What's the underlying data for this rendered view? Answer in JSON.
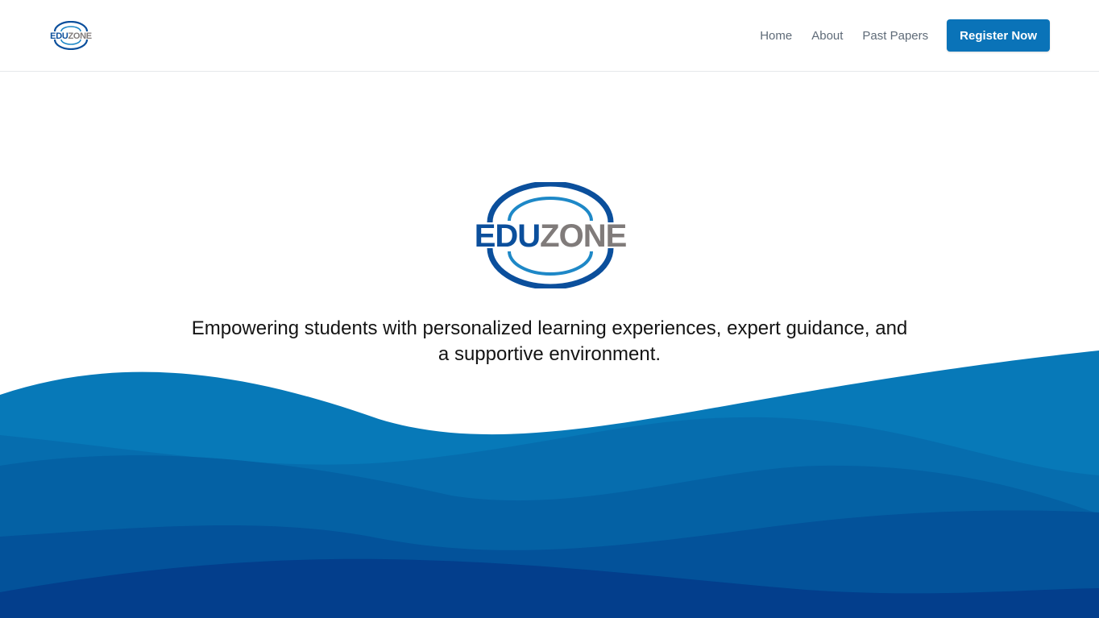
{
  "brand": {
    "logo_text_part1": "EDU",
    "logo_text_part2": "ZONE",
    "logo_alt": "EDUZONE",
    "colors": {
      "blue": "#0b4f9c",
      "light_blue": "#1e88c7",
      "gray": "#807b7a"
    }
  },
  "nav": {
    "items": [
      {
        "label": "Home"
      },
      {
        "label": "About"
      },
      {
        "label": "Past Papers"
      }
    ],
    "cta_label": "Register Now"
  },
  "hero": {
    "tagline": "Empowering students with personalized learning experiences, expert guidance, and a supportive environment."
  },
  "theme": {
    "primary": "#0a73b8",
    "nav_text": "#5f6b78",
    "wave_colors": [
      "#0779b8",
      "#066dae",
      "#0461a4",
      "#03529a",
      "#033e8c"
    ]
  }
}
